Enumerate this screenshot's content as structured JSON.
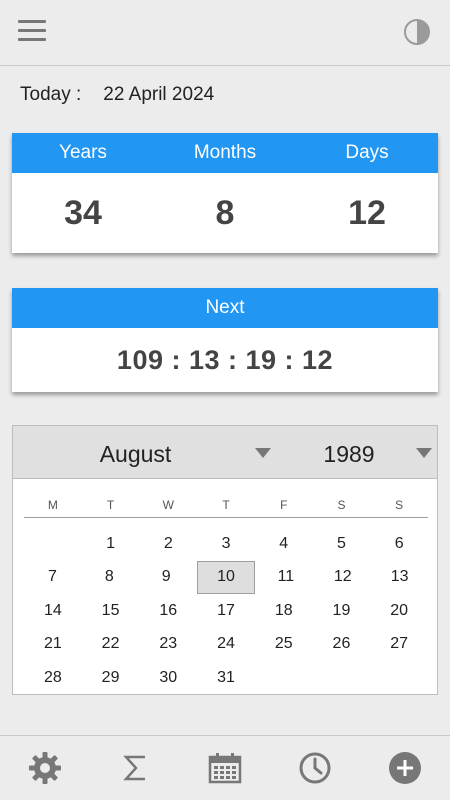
{
  "header": {
    "menu_icon": "hamburger-menu-icon",
    "theme_icon": "contrast-toggle-icon"
  },
  "today": {
    "label": "Today :",
    "date": "22 April 2024"
  },
  "age": {
    "headers": [
      "Years",
      "Months",
      "Days"
    ],
    "values": [
      "34",
      "8",
      "12"
    ]
  },
  "next_birthday": {
    "label": "Next",
    "countdown": "109 : 13 : 19 : 12"
  },
  "calendar": {
    "month": "August",
    "year": "1989",
    "weekdays": [
      "M",
      "T",
      "W",
      "T",
      "F",
      "S",
      "S"
    ],
    "weeks": [
      [
        "",
        "1",
        "2",
        "3",
        "4",
        "5",
        "6"
      ],
      [
        "7",
        "8",
        "9",
        "10",
        "11",
        "12",
        "13"
      ],
      [
        "14",
        "15",
        "16",
        "17",
        "18",
        "19",
        "20"
      ],
      [
        "21",
        "22",
        "23",
        "24",
        "25",
        "26",
        "27"
      ],
      [
        "28",
        "29",
        "30",
        "31",
        "",
        "",
        ""
      ]
    ],
    "selected_day": "10"
  },
  "bottom_nav": [
    "settings-icon",
    "sum-icon",
    "calendar-icon",
    "clock-icon",
    "add-icon"
  ],
  "colors": {
    "accent": "#2196f3",
    "background": "#ececec",
    "icon": "#777777"
  }
}
